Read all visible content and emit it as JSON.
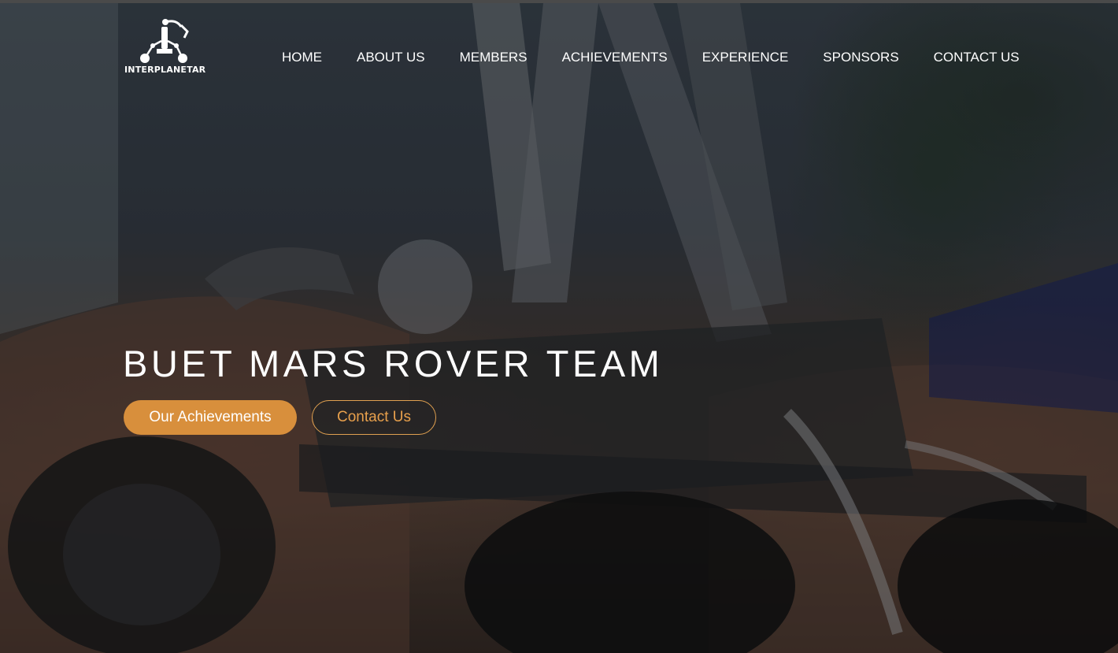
{
  "brand": {
    "name": "INTERPLANETAR",
    "logo_icon": "robotic-arm-logo"
  },
  "nav": {
    "items": [
      {
        "label": "HOME"
      },
      {
        "label": "ABOUT US"
      },
      {
        "label": "MEMBERS"
      },
      {
        "label": "ACHIEVEMENTS"
      },
      {
        "label": "EXPERIENCE"
      },
      {
        "label": "SPONSORS"
      },
      {
        "label": "CONTACT US"
      }
    ]
  },
  "hero": {
    "title": "BUET MARS ROVER TEAM",
    "primary_button": "Our Achievements",
    "secondary_button": "Contact Us",
    "background": "mars-rover-photo"
  },
  "colors": {
    "accent": "#d88f3c",
    "accent_outline": "#e0a050",
    "text": "#ffffff"
  }
}
